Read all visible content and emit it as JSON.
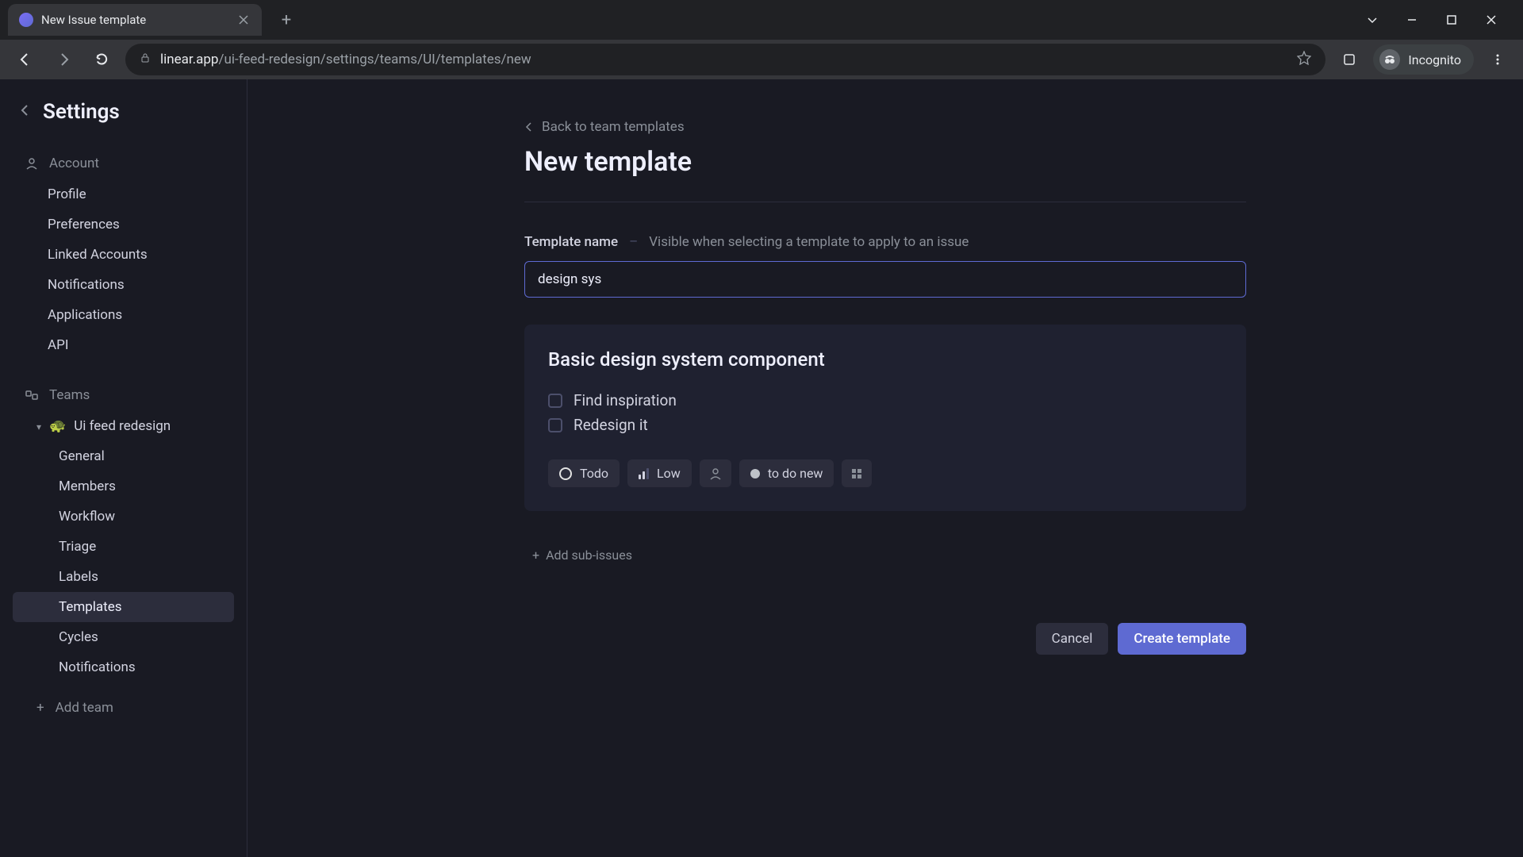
{
  "browser": {
    "tab_title": "New Issue template",
    "url_host": "linear.app",
    "url_path": "/ui-feed-redesign/settings/teams/UI/templates/new",
    "incognito_label": "Incognito"
  },
  "sidebar": {
    "title": "Settings",
    "account": {
      "label": "Account",
      "items": [
        "Profile",
        "Preferences",
        "Linked Accounts",
        "Notifications",
        "Applications",
        "API"
      ]
    },
    "teams": {
      "label": "Teams",
      "team_name": "Ui feed redesign",
      "team_emoji": "🐢",
      "items": [
        "General",
        "Members",
        "Workflow",
        "Triage",
        "Labels",
        "Templates",
        "Cycles",
        "Notifications"
      ],
      "active_index": 5,
      "add_team": "Add team"
    }
  },
  "main": {
    "breadcrumb": "Back to team templates",
    "title": "New template",
    "field": {
      "label": "Template name",
      "hint": "Visible when selecting a template to apply to an issue",
      "value": "design sys"
    },
    "editor": {
      "title": "Basic design system component",
      "checklist": [
        "Find inspiration",
        "Redesign it"
      ],
      "pills": {
        "status": "Todo",
        "priority": "Low",
        "label": "to do new"
      }
    },
    "add_sub": "Add sub-issues",
    "actions": {
      "cancel": "Cancel",
      "create": "Create template"
    }
  }
}
